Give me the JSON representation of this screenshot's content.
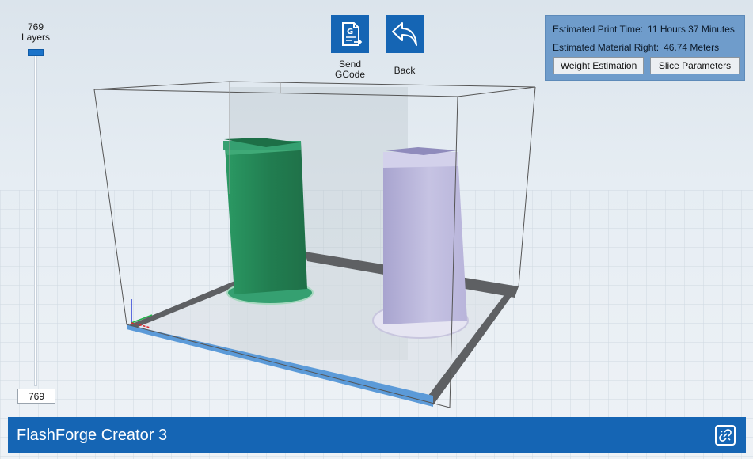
{
  "slider": {
    "layer_count": "769",
    "layers_label": "Layers",
    "current_layer": "769"
  },
  "toolbar": {
    "send_label_line1": "Send",
    "send_label_line2": "GCode",
    "back_label": "Back",
    "send_icon": "gcode-file-icon",
    "back_icon": "back-arrow-icon"
  },
  "info": {
    "print_time_label": "Estimated Print Time:",
    "print_time_value": "11 Hours 37 Minutes",
    "material_label": "Estimated Material Right:",
    "material_value": "46.74 Meters",
    "weight_button": "Weight Estimation",
    "slice_button": "Slice Parameters"
  },
  "status": {
    "printer_name": "FlashForge Creator 3",
    "connect_icon": "link-icon"
  },
  "scene": {
    "left_model_color": "#2c8a5a",
    "right_model_color": "#c9c6e4",
    "bed_border_color": "#5e6063",
    "bed_front_edge_color": "#5b9ad8",
    "header_color": "#1565b4"
  }
}
